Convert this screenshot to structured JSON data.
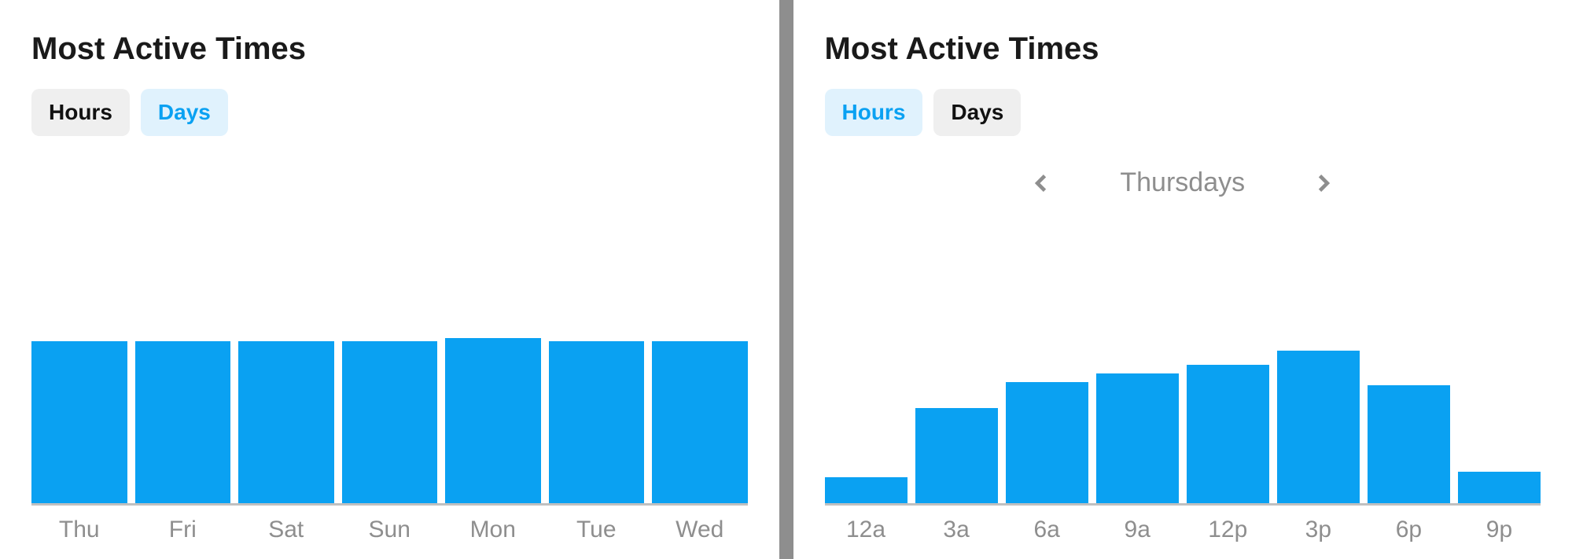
{
  "left": {
    "title": "Most Active Times",
    "tabs": {
      "hours": "Hours",
      "days": "Days",
      "active": "days"
    }
  },
  "right": {
    "title": "Most Active Times",
    "tabs": {
      "hours": "Hours",
      "days": "Days",
      "active": "hours"
    },
    "selector_label": "Thursdays"
  },
  "colors": {
    "accent": "#0aa1f2",
    "bar": "#0aa1f2",
    "tab_active_bg": "#e0f2fd",
    "tab_bg": "#efefef",
    "muted": "#8e8e8e"
  },
  "chart_data": [
    {
      "type": "bar",
      "title": "Most Active Times — Days",
      "categories": [
        "Thu",
        "Fri",
        "Sat",
        "Sun",
        "Mon",
        "Tue",
        "Wed"
      ],
      "values": [
        98,
        98,
        98,
        98,
        100,
        98,
        98
      ],
      "ylim": [
        0,
        100
      ],
      "xlabel": "",
      "ylabel": ""
    },
    {
      "type": "bar",
      "title": "Most Active Times — Hours (Thursdays)",
      "categories": [
        "12a",
        "3a",
        "6a",
        "9a",
        "12p",
        "3p",
        "6p",
        "9p"
      ],
      "values": [
        15,
        55,
        70,
        75,
        80,
        88,
        68,
        18
      ],
      "ylim": [
        0,
        100
      ],
      "xlabel": "",
      "ylabel": ""
    }
  ]
}
